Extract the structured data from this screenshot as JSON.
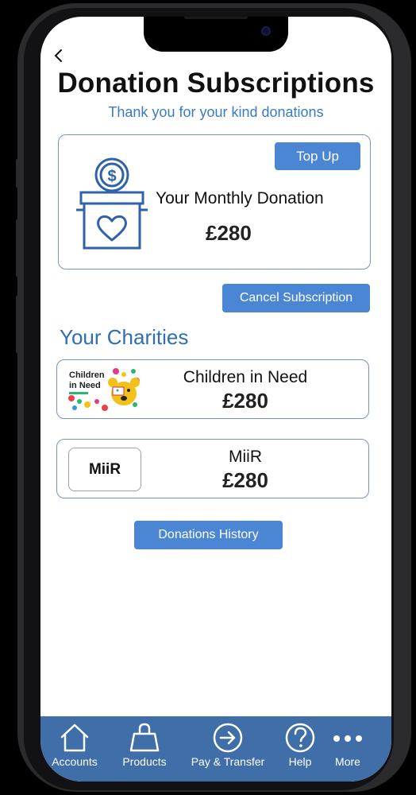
{
  "header": {
    "title": "Donation Subscriptions",
    "subtitle": "Thank you for your kind donations"
  },
  "monthly": {
    "top_up_label": "Top Up",
    "label": "Your Monthly Donation",
    "amount": "£280",
    "icon": "donation-box-icon"
  },
  "cancel_label": "Cancel Subscription",
  "charities": {
    "title": "Your Charities",
    "items": [
      {
        "name": "Children in Need",
        "amount": "£280",
        "logo_text": "Children in Need"
      },
      {
        "name": "MiiR",
        "amount": "£280",
        "logo_text": "MiiR"
      }
    ]
  },
  "history_label": "Donations History",
  "tabbar": {
    "items": [
      {
        "label": "Accounts",
        "icon": "home-icon"
      },
      {
        "label": "Products",
        "icon": "bag-icon"
      },
      {
        "label": "Pay & Transfer",
        "icon": "arrow-circle-icon"
      },
      {
        "label": "Help",
        "icon": "question-icon"
      },
      {
        "label": "More",
        "icon": "more-dots-icon"
      }
    ]
  },
  "colors": {
    "accent": "#4a86d4",
    "title_blue": "#2f6db5",
    "tabbar": "#3f6ea8"
  }
}
